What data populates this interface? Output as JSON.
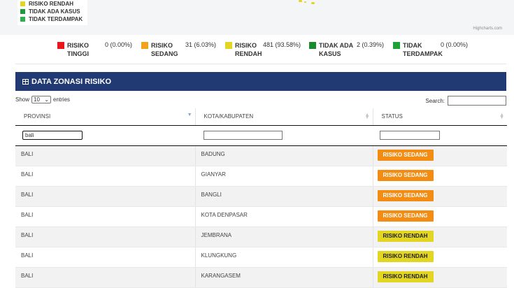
{
  "map_legend": [
    {
      "label": "RISIKO RENDAH",
      "color": "#e2d623"
    },
    {
      "label": "TIDAK ADA KASUS",
      "color": "#1f9a3a"
    },
    {
      "label": "TIDAK TERDAMPAK",
      "color": "#2bb24c"
    }
  ],
  "map_credit": "Highcharts.com",
  "summary": [
    {
      "label_line1": "RISIKO",
      "label_line2": "TINGGI",
      "value": "0 (0.00%)",
      "color": "#e8171c"
    },
    {
      "label_line1": "RISIKO",
      "label_line2": "SEDANG",
      "value": "31 (6.03%)",
      "color": "#f2a21b"
    },
    {
      "label_line1": "RISIKO",
      "label_line2": "RENDAH",
      "value": "481 (93.58%)",
      "color": "#e2d623"
    },
    {
      "label_line1": "TIDAK ADA",
      "label_line2": "KASUS",
      "value": "2 (0.39%)",
      "color": "#1b8a2e"
    },
    {
      "label_line1": "TIDAK",
      "label_line2": "TERDAMPAK",
      "value": "0 (0.00%)",
      "color": "#1fa137"
    }
  ],
  "panel": {
    "title": "DATA ZONASI RISIKO"
  },
  "controls": {
    "show_label": "Show",
    "page_size": "10",
    "entries_label": "entries",
    "search_label": "Search:",
    "search_value": ""
  },
  "table": {
    "columns": [
      "PROVINSI",
      "KOTA/KABUPATEN",
      "STATUS"
    ],
    "filters": [
      "bali",
      "",
      ""
    ],
    "rows": [
      {
        "provinsi": "BALI",
        "kota": "BADUNG",
        "status": "RISIKO SEDANG",
        "level": "sedang"
      },
      {
        "provinsi": "BALI",
        "kota": "GIANYAR",
        "status": "RISIKO SEDANG",
        "level": "sedang"
      },
      {
        "provinsi": "BALI",
        "kota": "BANGLI",
        "status": "RISIKO SEDANG",
        "level": "sedang"
      },
      {
        "provinsi": "BALI",
        "kota": "KOTA DENPASAR",
        "status": "RISIKO SEDANG",
        "level": "sedang"
      },
      {
        "provinsi": "BALI",
        "kota": "JEMBRANA",
        "status": "RISIKO RENDAH",
        "level": "rendah"
      },
      {
        "provinsi": "BALI",
        "kota": "KLUNGKUNG",
        "status": "RISIKO RENDAH",
        "level": "rendah"
      },
      {
        "provinsi": "BALI",
        "kota": "KARANGASEM",
        "status": "RISIKO RENDAH",
        "level": "rendah"
      }
    ]
  }
}
